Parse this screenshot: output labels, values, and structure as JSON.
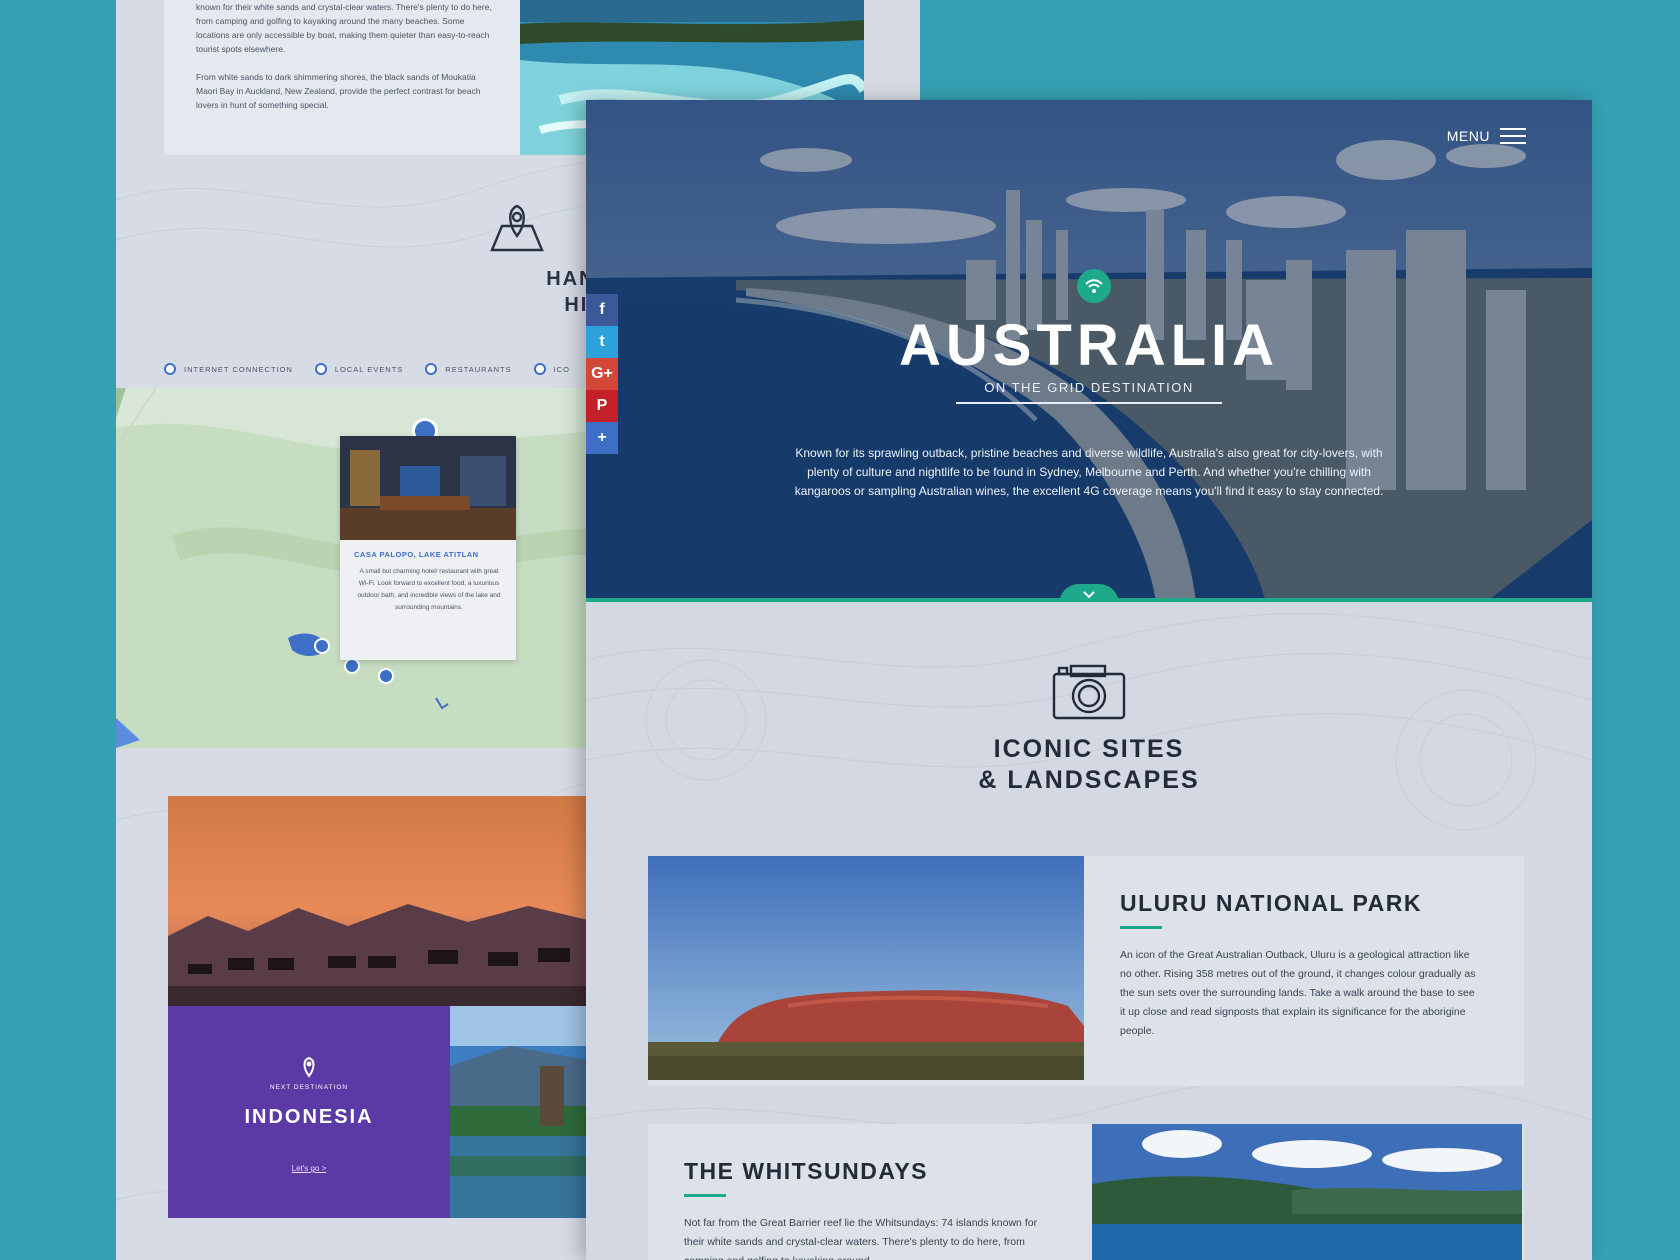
{
  "back_page": {
    "intro_text_1": "known for their white sands and crystal-clear waters. There's plenty to do here, from camping and golfing to kayaking around the many beaches. Some locations are only accessible by boat, making them quieter than easy-to-reach tourist spots elsewhere.",
    "intro_text_2": "From white sands to dark shimmering shores, the black sands of Moukatia Maori Bay in Auckland, New Zealand, provide the perfect contrast for beach lovers in hunt of something special.",
    "highlights_title_line1": "HANDPICKED M",
    "highlights_title_line2": "HIGHLIGHTS",
    "legend": [
      "INTERNET CONNECTION",
      "LOCAL EVENTS",
      "RESTAURANTS",
      "ICO"
    ],
    "map_card": {
      "title": "CASA PALOPO, LAKE ATITLAN",
      "text": "A small but charming hotel/ restaurant with great Wi-Fi. Look forward to excellent food, a luxurious outdoor bath, and incredible views of the lake and surrounding mountains."
    },
    "next_destination": {
      "label": "NEXT DESTINATION",
      "title": "INDONESIA",
      "link": "Let's go >"
    }
  },
  "front_page": {
    "menu_label": "MENU",
    "hero_title": "AUSTRALIA",
    "hero_subtitle": "ON THE GRID DESTINATION",
    "hero_text": "Known for its sprawling outback, pristine beaches and diverse wildlife, Australia's also great for city-lovers, with plenty of culture and nightlife to be found in Sydney, Melbourne and Perth. And whether you're chilling with kangaroos or sampling Australian wines, the excellent 4G coverage means you'll find it easy to stay connected.",
    "social": [
      {
        "icon": "facebook-icon",
        "glyph": "f",
        "color": "#3b5998"
      },
      {
        "icon": "twitter-icon",
        "glyph": "t",
        "color": "#2da1d9"
      },
      {
        "icon": "google-plus-icon",
        "glyph": "G+",
        "color": "#d3473a"
      },
      {
        "icon": "pinterest-icon",
        "glyph": "P",
        "color": "#c42028"
      },
      {
        "icon": "plus-icon",
        "glyph": "+",
        "color": "#3d6fc7"
      }
    ],
    "section_title_line1": "ICONIC SITES",
    "section_title_line2": "& LANDSCAPES",
    "uluru": {
      "title": "ULURU NATIONAL PARK",
      "text": "An icon of the Great Australian Outback, Uluru is a geological attraction like no other. Rising 358 metres out of the ground, it changes colour gradually as the sun sets over the surrounding lands. Take a walk around the base to see it up close and read signposts that explain its significance for the aborigine people."
    },
    "whitsundays": {
      "title": "THE WHITSUNDAYS",
      "text": "Not far from the Great Barrier reef lie the Whitsundays: 74 islands known for their white sands and crystal-clear waters. There's plenty to do here, from camping and golfing to kayaking around"
    }
  },
  "colors": {
    "background": "#35a0b3",
    "accent_green": "#1ea98a",
    "next_destination_purple": "#5b3aa6",
    "map_blue": "#3d6fc7"
  }
}
